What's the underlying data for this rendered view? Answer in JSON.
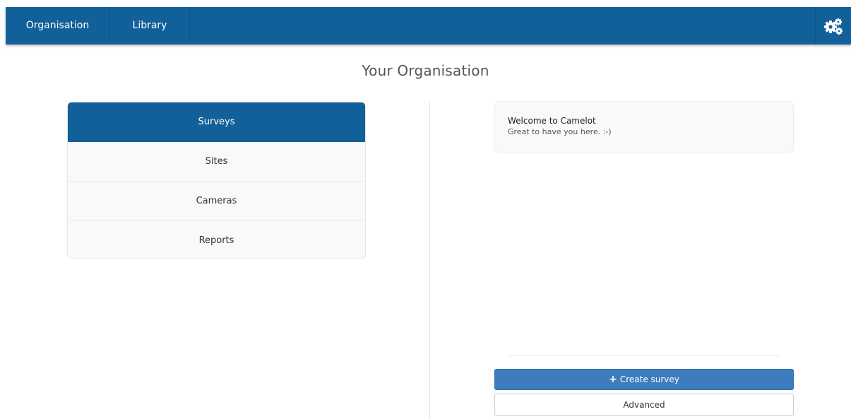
{
  "nav": {
    "tabs": [
      {
        "label": "Organisation"
      },
      {
        "label": "Library"
      }
    ],
    "settings_icon": "gears-icon"
  },
  "page": {
    "title": "Your Organisation"
  },
  "menu": {
    "items": [
      {
        "label": "Surveys",
        "active": true
      },
      {
        "label": "Sites",
        "active": false
      },
      {
        "label": "Cameras",
        "active": false
      },
      {
        "label": "Reports",
        "active": false
      }
    ]
  },
  "welcome": {
    "title": "Welcome to Camelot",
    "text": "Great to have you here. :-)"
  },
  "actions": {
    "create_icon": "plus-icon",
    "create_label": "Create survey",
    "advanced_label": "Advanced"
  },
  "colors": {
    "brand": "#126099",
    "primary_button": "#3d7dbd"
  }
}
